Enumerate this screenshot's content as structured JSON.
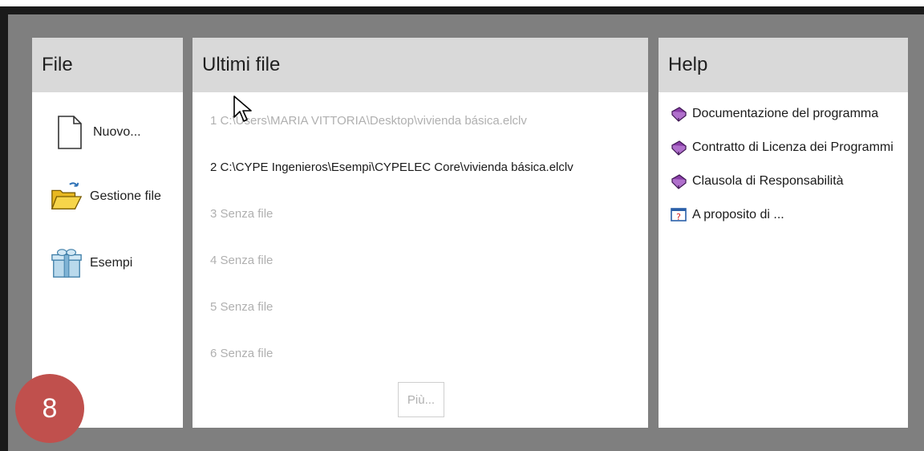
{
  "file_panel": {
    "title": "File",
    "items": [
      {
        "label": "Nuovo...",
        "icon": "new-document-icon"
      },
      {
        "label": "Gestione file",
        "icon": "open-folder-icon"
      },
      {
        "label": "Esempi",
        "icon": "gift-examples-icon"
      }
    ]
  },
  "recent_panel": {
    "title": "Ultimi file",
    "items": [
      {
        "text": "1 C:\\Users\\MARIA VITTORIA\\Desktop\\vivienda básica.elclv"
      },
      {
        "text": "2 C:\\CYPE Ingenieros\\Esempi\\CYPELEC Core\\vivienda básica.elclv"
      },
      {
        "text": "3 Senza file"
      },
      {
        "text": "4 Senza file"
      },
      {
        "text": "5 Senza file"
      },
      {
        "text": "6 Senza file"
      }
    ],
    "more_label": "Più..."
  },
  "help_panel": {
    "title": "Help",
    "items": [
      {
        "label": "Documentazione del programma",
        "icon": "book-icon"
      },
      {
        "label": "Contratto di Licenza dei Programmi",
        "icon": "book-icon"
      },
      {
        "label": "Clausola di Responsabilità",
        "icon": "book-icon"
      },
      {
        "label": "A proposito di ...",
        "icon": "about-help-icon"
      }
    ]
  },
  "badge": {
    "text": "8"
  },
  "colors": {
    "badge": "#c0504d",
    "header": "#d9d9d9",
    "background": "#7f7f7f"
  }
}
